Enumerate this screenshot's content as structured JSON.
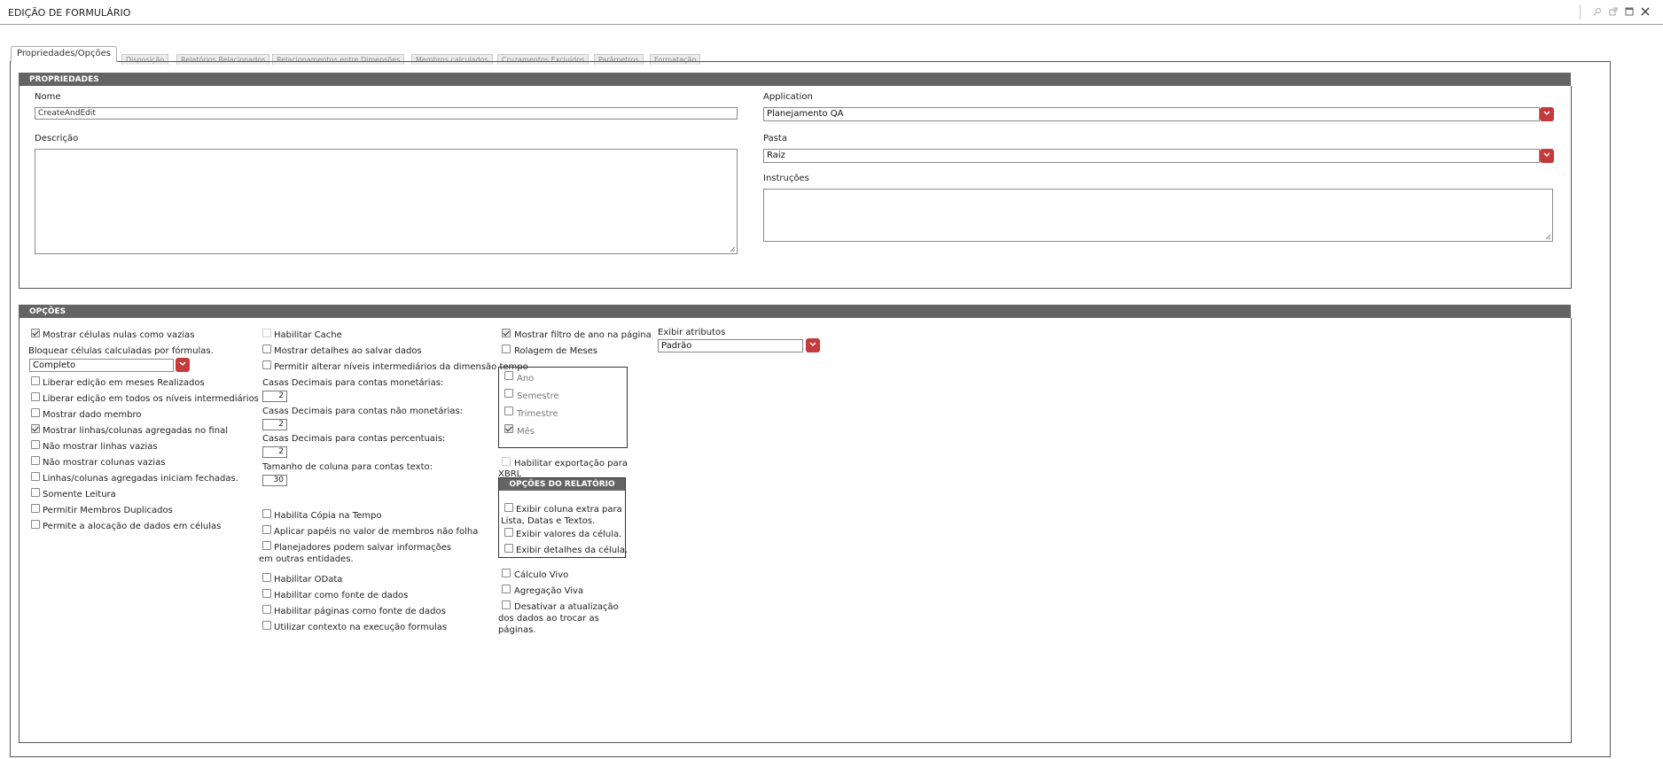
{
  "window": {
    "title": "EDIÇÃO DE FORMULÁRIO"
  },
  "tabs": [
    "Propriedades/Opções",
    "Disposição",
    "Relatórios Relacionados",
    "Relacionamentos entre Dimensões",
    "Membros calculados",
    "Cruzamentos Excluídos",
    "Parâmetros",
    "Formatação"
  ],
  "properties": {
    "header": "PROPRIEDADES",
    "name_label": "Nome",
    "name_value": "CreateAndEdit",
    "description_label": "Descrição",
    "application_label": "Application",
    "application_value": "Planejamento QA",
    "folder_label": "Pasta",
    "folder_value": "Raiz",
    "instructions_label": "Instruções"
  },
  "options": {
    "header": "OPÇÕES",
    "col1": {
      "show_nulls": "Mostrar células nulas como vazias",
      "block_calc_label": "Bloquear células calculadas por fórmulas.",
      "block_calc_value": "Completo",
      "items": [
        {
          "label": "Liberar edição em meses Realizados",
          "checked": false
        },
        {
          "label": "Liberar edição em todos os níveis intermediários",
          "checked": false
        },
        {
          "label": "Mostrar dado membro",
          "checked": false
        },
        {
          "label": "Mostrar linhas/colunas agregadas no final",
          "checked": true
        },
        {
          "label": "Não mostrar linhas vazias",
          "checked": false
        },
        {
          "label": "Não mostrar colunas vazias",
          "checked": false
        },
        {
          "label": "Linhas/colunas agregadas iniciam fechadas.",
          "checked": false
        },
        {
          "label": "Somente Leitura",
          "checked": false
        },
        {
          "label": "Permitir Membros Duplicados",
          "checked": false
        },
        {
          "label": "Permite a alocação de dados em células",
          "checked": false
        }
      ]
    },
    "col2": {
      "enable_cache": "Habilitar Cache",
      "show_details_save": "Mostrar detalhes ao salvar dados",
      "allow_levels": "Permitir alterar níveis intermediários da dimensão tempo",
      "dec_monetary_label": "Casas Decimais para contas monetárias:",
      "dec_monetary_value": "2",
      "dec_nonmonetary_label": "Casas Decimais para contas não monetárias:",
      "dec_nonmonetary_value": "2",
      "dec_percent_label": "Casas Decimais para contas percentuais:",
      "dec_percent_value": "2",
      "col_size_label": "Tamanho de coluna para contas texto:",
      "col_size_value": "30",
      "copy_time": "Habilita Cópia na Tempo",
      "apply_roles": "Aplicar papéis no valor de membros não folha",
      "planners_line1": "Planejadores podem salvar informações",
      "planners_line2": "em outras entidades.",
      "odata": "Habilitar OData",
      "datasource": "Habilitar como fonte de dados",
      "pages_datasource": "Habilitar páginas como fonte de dados",
      "context_formulas": "Utilizar contexto na execução formulas"
    },
    "col3": {
      "year_filter": "Mostrar filtro de ano na página",
      "rolling_months": "Rolagem de Meses",
      "periods": [
        {
          "label": "Ano",
          "checked": false
        },
        {
          "label": "Semestre",
          "checked": false
        },
        {
          "label": "Trimestre",
          "checked": false
        },
        {
          "label": "Mês",
          "checked": true
        }
      ],
      "xbrl_line1": "Habilitar exportação para",
      "xbrl_line2": "XBRL",
      "report_header": "OPÇÕES DO RELATÓRIO",
      "extra_col_line1": "Exibir coluna extra para",
      "extra_col_line2": "Lista, Datas e Textos.",
      "cell_values": "Exibir valores da célula.",
      "cell_details": "Exibir detalhes da célula.",
      "live_calc": "Cálculo Vivo",
      "live_agg": "Agregação Viva",
      "disable_update_line1": "Desativar a atualização",
      "disable_update_line2": "dos dados ao trocar as",
      "disable_update_line3": "páginas."
    },
    "col4": {
      "attributes_label": "Exibir atributos",
      "attributes_value": "Padrão"
    }
  },
  "colors": {
    "header_bg": "#646464",
    "dropdown_btn": "#c33b3b"
  }
}
